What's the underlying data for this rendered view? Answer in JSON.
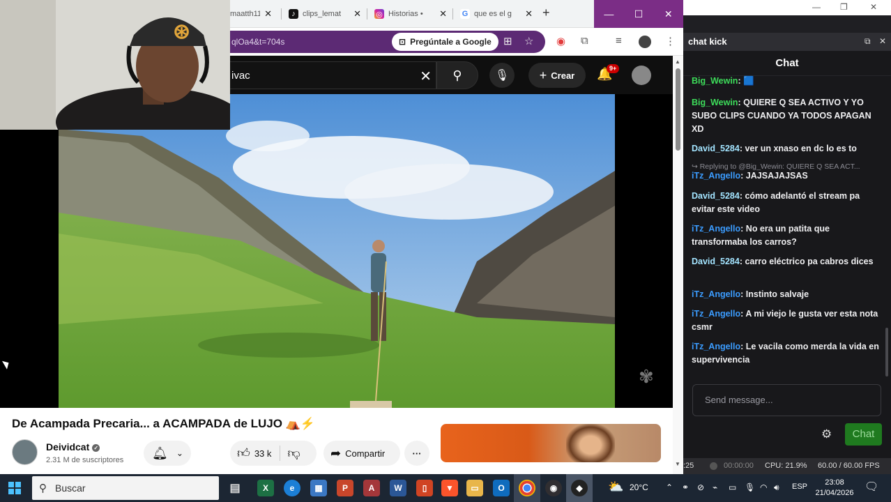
{
  "browser": {
    "tabs": [
      {
        "label": "maatth11",
        "icon": "youtube-icon"
      },
      {
        "label": "clips_lemat",
        "icon": "tiktok-icon"
      },
      {
        "label": "Historias •",
        "icon": "instagram-icon"
      },
      {
        "label": "que es el g",
        "icon": "google-icon"
      }
    ],
    "url_fragment": "qlOa4&t=704s",
    "ask_google_label": "Pregúntale a Google"
  },
  "youtube": {
    "search_value": "ivac",
    "create_label": "Crear",
    "notification_count": "9+",
    "video_title": "De Acampada Precaria... a ACAMPADA de LUJO ⛺⚡",
    "channel_name": "Deividcat",
    "subscribers": "2.31 M de suscriptores",
    "likes": "33 k",
    "share_label": "Compartir",
    "more_label": "···"
  },
  "chat_window": {
    "window_title": "chat kick",
    "panel_title": "Chat",
    "messages": [
      {
        "user": "Big_Wewin",
        "text": " 🟦",
        "user_color": "#3ddc5a"
      },
      {
        "user": "Big_Wewin",
        "text": "QUIERE Q SEA ACTIVO Y YO SUBO CLIPS CUANDO YA TODOS APAGAN XD",
        "user_color": "#3ddc5a"
      },
      {
        "user": "David_5284",
        "text": "ver un xnaso en dc lo es to",
        "user_color": "#a3e4ff"
      },
      {
        "user": "iTz_Angello",
        "text": "JAJSAJAJSAS",
        "user_color": "#3b9cff",
        "reply": "↪ Replying to @Big_Wewin: QUIERE Q SEA ACT..."
      },
      {
        "user": "David_5284",
        "text": "cómo adelantó el stream pa evitar este video",
        "user_color": "#a3e4ff"
      },
      {
        "user": "iTz_Angello",
        "text": "No era un patita que transformaba los carros?",
        "user_color": "#3b9cff"
      },
      {
        "user": "David_5284",
        "text": "carro eléctrico pa cabros dices",
        "user_color": "#a3e4ff"
      },
      {
        "user": "iTz_Angello",
        "text": "Instinto salvaje",
        "user_color": "#3b9cff"
      },
      {
        "user": "iTz_Angello",
        "text": "A mi viejo le gusta ver esta nota csmr",
        "user_color": "#3b9cff"
      },
      {
        "user": "iTz_Angello",
        "text": "Le vacila como merda la vida en supervivencia",
        "user_color": "#3b9cff"
      }
    ],
    "input_placeholder": "Send message...",
    "send_label": "Chat"
  },
  "obs_status": {
    "time_left": ":25",
    "rec_time": "00:00:00",
    "cpu": "CPU: 21.9%",
    "fps": "60.00 / 60.00 FPS"
  },
  "taskbar": {
    "search_placeholder": "Buscar",
    "weather": "20°C",
    "language": "ESP",
    "time": "23:08",
    "date": "21/04/2026"
  }
}
